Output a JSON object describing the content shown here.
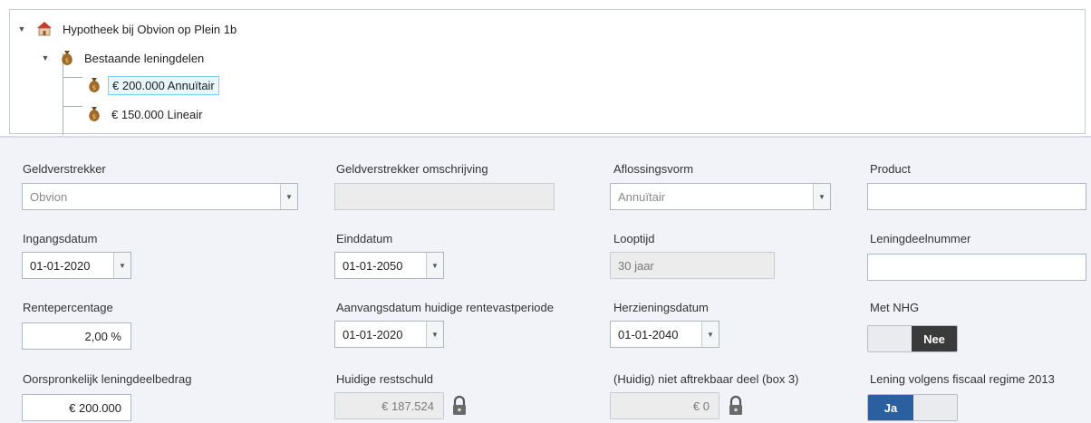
{
  "tree": {
    "root": {
      "label": "Hypotheek bij Obvion op Plein 1b",
      "icon": "house-icon"
    },
    "group": {
      "label": "Bestaande leningdelen",
      "icon": "money-bag-icon"
    },
    "items": [
      {
        "label": "€ 200.000 Annuïtair",
        "icon": "money-bag-icon",
        "selected": true
      },
      {
        "label": "€ 150.000 Lineair",
        "icon": "money-bag-icon",
        "selected": false
      }
    ]
  },
  "form": {
    "geldverstrekker": {
      "label": "Geldverstrekker",
      "value": "Obvion"
    },
    "omschrijving": {
      "label": "Geldverstrekker omschrijving",
      "value": ""
    },
    "aflossingsvorm": {
      "label": "Aflossingsvorm",
      "value": "Annuïtair"
    },
    "product": {
      "label": "Product",
      "value": ""
    },
    "ingangsdatum": {
      "label": "Ingangsdatum",
      "value": "01-01-2020"
    },
    "einddatum": {
      "label": "Einddatum",
      "value": "01-01-2050"
    },
    "looptijd": {
      "label": "Looptijd",
      "value": "30 jaar"
    },
    "leningdeelnummer": {
      "label": "Leningdeelnummer",
      "value": ""
    },
    "rentepercentage": {
      "label": "Rentepercentage",
      "value": "2,00 %"
    },
    "aanvangsdatum": {
      "label": "Aanvangsdatum huidige rentevastperiode",
      "value": "01-01-2020"
    },
    "herzieningsdatum": {
      "label": "Herzieningsdatum",
      "value": "01-01-2040"
    },
    "nhg": {
      "label": "Met NHG",
      "value": "Nee"
    },
    "oorspronkelijk": {
      "label": "Oorspronkelijk leningdeelbedrag",
      "value": "€ 200.000"
    },
    "restschuld": {
      "label": "Huidige restschuld",
      "value": "€ 187.524"
    },
    "box3": {
      "label": "(Huidig) niet aftrekbaar deel (box 3)",
      "value": "€ 0"
    },
    "fiscaal": {
      "label": "Lening volgens fiscaal regime 2013",
      "value": "Ja"
    }
  },
  "colors": {
    "toggle_off": "#3a3a3a",
    "toggle_on": "#2a5fa0",
    "selection": "#7ad3f0"
  }
}
